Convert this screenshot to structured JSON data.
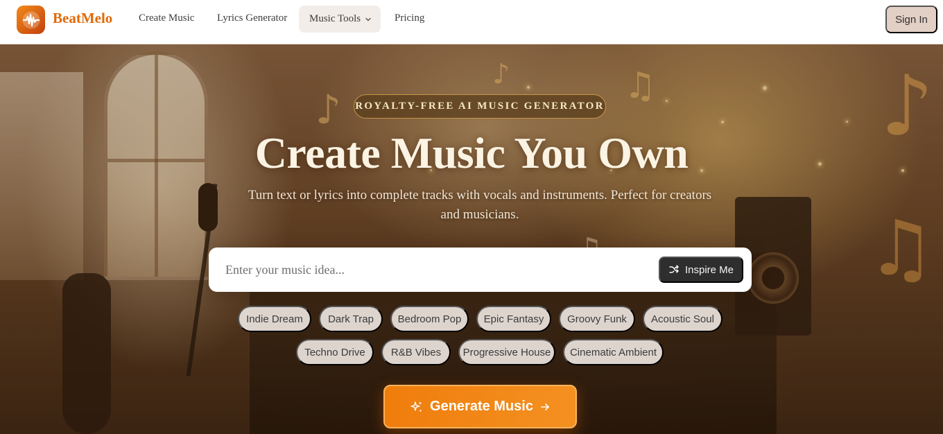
{
  "brand": {
    "name": "BeatMelo",
    "accent": "#e16a08"
  },
  "nav": {
    "links": [
      "Create Music",
      "Lyrics Generator",
      "Pricing"
    ],
    "tools_label": "Music Tools",
    "signin_label": "Sign In"
  },
  "hero": {
    "badge": "ROYALTY-FREE AI MUSIC GENERATOR",
    "title": "Create Music You Own",
    "subtitle": "Turn text or lyrics into complete tracks with vocals and instruments. Perfect for creators and musicians.",
    "search_placeholder": "Enter your music idea...",
    "inspire_label": "Inspire Me",
    "styles_row1": [
      "Indie Dream",
      "Dark Trap",
      "Bedroom Pop",
      "Epic Fantasy",
      "Groovy Funk",
      "Acoustic Soul"
    ],
    "styles_row2": [
      "Techno Drive",
      "R&B Vibes",
      "Progressive House",
      "Cinematic Ambient"
    ],
    "generate_label": "Generate Music"
  },
  "icons": {
    "logo": "waveform-icon",
    "tools": "chevron-down-icon",
    "inspire": "shuffle-icon",
    "generate": "sparkles-icon",
    "arrow": "arrow-right-icon"
  }
}
